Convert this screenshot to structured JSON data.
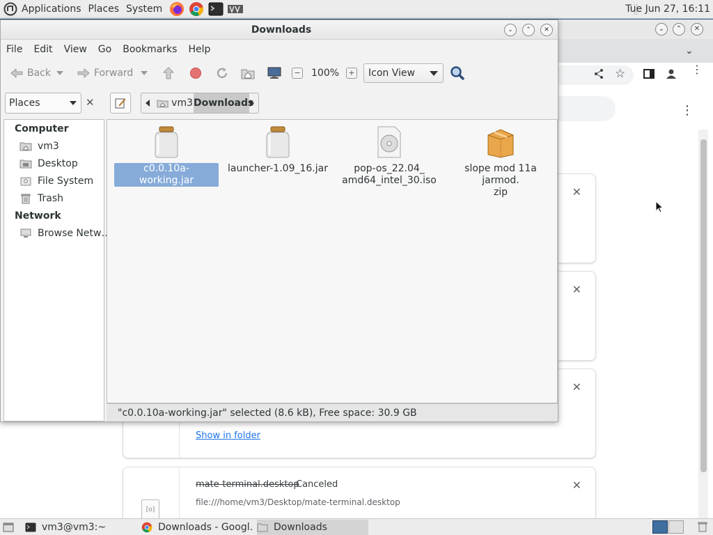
{
  "top_panel": {
    "menus": [
      "Applications",
      "Places",
      "System"
    ],
    "clock": "Tue Jun 27, 16:11"
  },
  "browser": {
    "downloads": [
      {
        "filename": "",
        "status": "",
        "link": "Show in folder",
        "path": ""
      },
      {
        "filename": "mate-terminal.desktop",
        "status": "Canceled",
        "link": "",
        "path": "file:///home/vm3/Desktop/mate-terminal.desktop"
      }
    ]
  },
  "file_manager": {
    "title": "Downloads",
    "menu": [
      "File",
      "Edit",
      "View",
      "Go",
      "Bookmarks",
      "Help"
    ],
    "toolbar": {
      "back": "Back",
      "forward": "Forward",
      "zoom": "100%",
      "view_mode": "Icon View"
    },
    "side_pane_selector": "Places",
    "path": {
      "home": "vm3",
      "current": "Downloads"
    },
    "sidebar": {
      "computer_heading": "Computer",
      "computer_items": [
        "vm3",
        "Desktop",
        "File System",
        "Trash"
      ],
      "network_heading": "Network",
      "network_items": [
        "Browse Netw…"
      ]
    },
    "files": [
      {
        "name": "c0.0.10a-working.jar",
        "icon": "jar-icon",
        "selected": true
      },
      {
        "name": "launcher-1.09_16.jar",
        "icon": "jar-icon",
        "selected": false
      },
      {
        "name": "pop-os_22.04_\namd64_intel_30.iso",
        "icon": "disc-image-icon",
        "selected": false
      },
      {
        "name": "slope mod 11a jarmod.\nzip",
        "icon": "archive-icon",
        "selected": false
      }
    ],
    "status": "\"c0.0.10a-working.jar\" selected (8.6 kB), Free space: 30.9 GB"
  },
  "taskbar": {
    "tasks": [
      "vm3@vm3:~",
      "Downloads - Googl…",
      "Downloads"
    ]
  }
}
